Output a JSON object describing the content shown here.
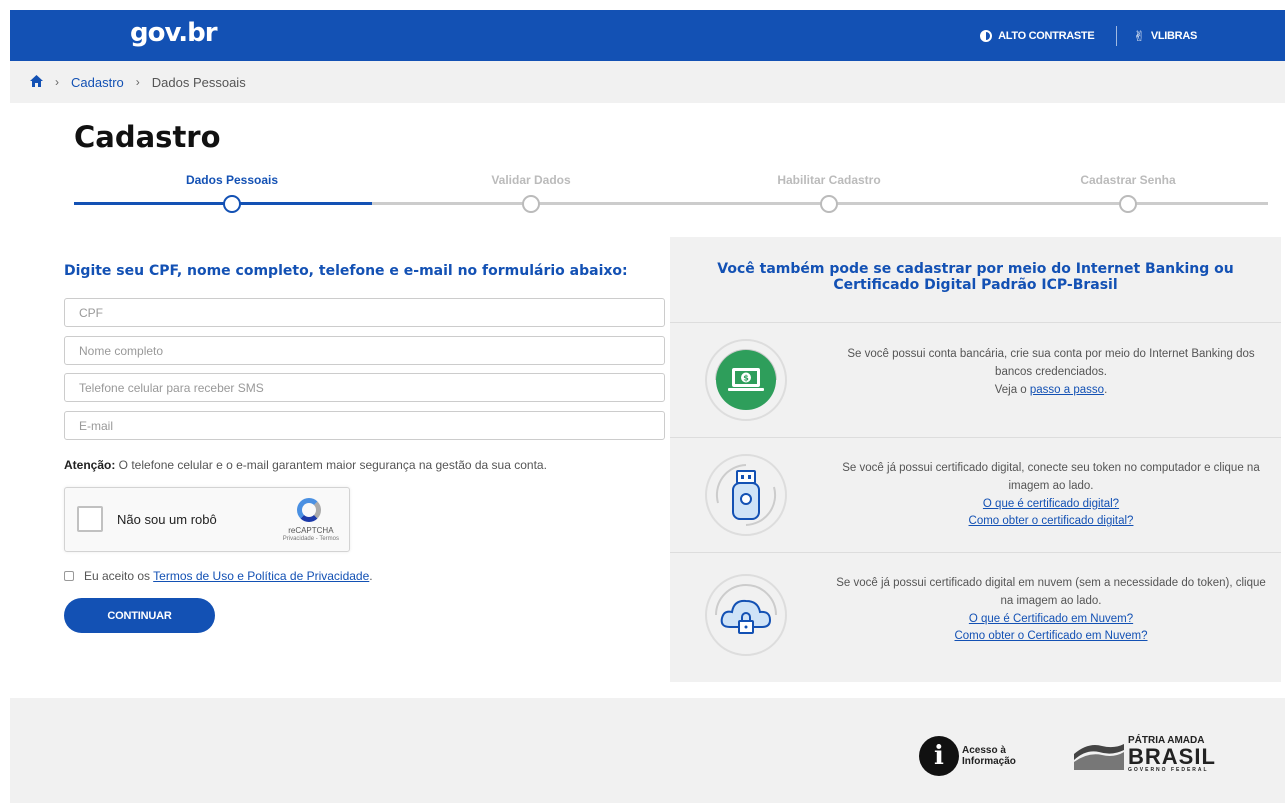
{
  "header": {
    "logo": "gov.br",
    "contrast_label": "ALTO CONTRASTE",
    "vlibras_label": "VLIBRAS"
  },
  "breadcrumb": {
    "items": [
      "Cadastro",
      "Dados Pessoais"
    ]
  },
  "page_title": "Cadastro",
  "stepper": {
    "steps": [
      {
        "label": "Dados Pessoais"
      },
      {
        "label": "Validar Dados"
      },
      {
        "label": "Habilitar Cadastro"
      },
      {
        "label": "Cadastrar Senha"
      }
    ],
    "current_step": 1
  },
  "form": {
    "heading": "Digite seu CPF, nome completo, telefone e e-mail no formulário abaixo:",
    "cpf_placeholder": "CPF",
    "name_placeholder": "Nome completo",
    "phone_placeholder": "Telefone celular para receber SMS",
    "email_placeholder": "E-mail",
    "attention_label": "Atenção:",
    "attention_text": " O telefone celular e o e-mail garantem maior segurança na gestão da sua conta.",
    "captcha_label": "Não sou um robô",
    "captcha_brand": "reCAPTCHA",
    "captcha_links": "Privacidade - Termos",
    "terms_prefix": "Eu aceito os ",
    "terms_link": "Termos de Uso e Política de Privacidade",
    "terms_suffix": ".",
    "continue_label": "CONTINUAR"
  },
  "right_panel": {
    "heading_line1": "Você também pode se cadastrar por meio do Internet Banking ou",
    "heading_line2": "Certificado Digital Padrão ICP-Brasil",
    "banking": {
      "text": "Se você possui conta bancária, crie sua conta por meio do Internet Banking dos bancos credenciados.",
      "see_prefix": "Veja o ",
      "see_link": "passo a passo",
      "see_suffix": "."
    },
    "token": {
      "text": "Se você já possui certificado digital, conecte seu token no computador e clique na imagem ao lado.",
      "link1": "O que é certificado digital?",
      "link2": "Como obter o certificado digital?"
    },
    "cloud": {
      "text": "Se você já possui certificado digital em nuvem (sem a necessidade do token), clique na imagem ao lado.",
      "link1": "O que é Certificado em Nuvem?",
      "link2": "Como obter o Certificado em Nuvem?"
    }
  },
  "footer": {
    "acesso_line1": "Acesso à",
    "acesso_line2": "Informação",
    "brasil_top": "PÁTRIA AMADA",
    "brasil_main": "BRASIL",
    "brasil_sub": "GOVERNO FEDERAL"
  },
  "colors": {
    "primary": "#1351b4",
    "panel_bg": "#f1f1f1",
    "icon_green": "#2e9e5b"
  }
}
